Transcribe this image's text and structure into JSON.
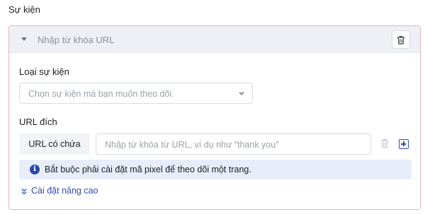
{
  "section": {
    "title": "Sự kiện"
  },
  "card": {
    "header_text": "Nhập từ khóa URL",
    "event_type": {
      "label": "Loại sự kiện",
      "placeholder": "Chọn sự kiện mà bạn muốn theo dõi."
    },
    "destination": {
      "label": "URL đích",
      "condition": "URL có chứa",
      "input_placeholder": "Nhập từ khóa từ URL, ví dụ như “thank you”"
    },
    "info_message": "Bắt buộc phải cài đặt mã pixel để theo dõi một trang.",
    "advanced_link": "Cài đặt nâng cao"
  },
  "colors": {
    "card_border": "#e8b3c0",
    "header_bg": "#eef0f6",
    "info_bg": "#e7eefa",
    "accent": "#2e4bb8"
  },
  "icons": {
    "header_caret": "caret-down-icon",
    "header_delete": "trash-icon",
    "select_chevron": "chevron-down-icon",
    "row_delete": "trash-icon",
    "row_add": "plus-square-icon",
    "info": "info-icon",
    "advanced": "double-chevron-down-icon"
  }
}
